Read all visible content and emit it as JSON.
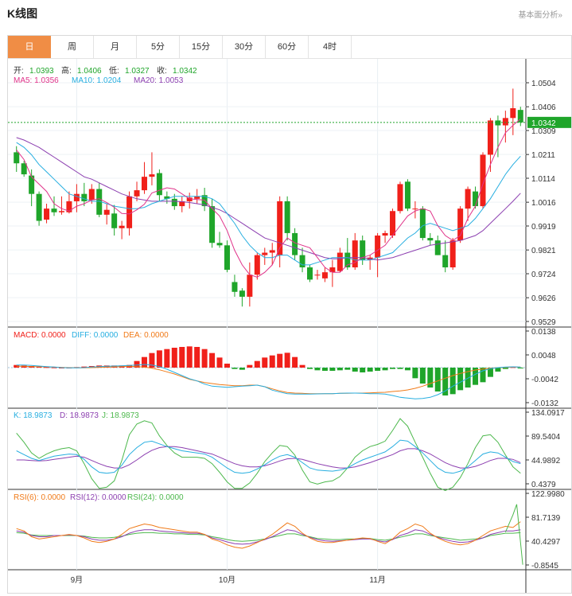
{
  "header": {
    "title": "K线图",
    "link": "基本面分析»"
  },
  "tabs": [
    "日",
    "周",
    "月",
    "5分",
    "15分",
    "30分",
    "60分",
    "4时"
  ],
  "active_tab": 0,
  "colors": {
    "up": "#f0201a",
    "down": "#1fa52a",
    "accent": "#f08d45",
    "ma5": "#e0338a",
    "ma10": "#27aee0",
    "ma20": "#8c3fb0",
    "k": "#27aee0",
    "d": "#8c3fb0",
    "j": "#4cb84c",
    "rsi6": "#f07a18",
    "rsi12": "#8c3fb0",
    "rsi24": "#4cb84c",
    "dea": "#f07a18",
    "diff": "#27aee0"
  },
  "ohlc": {
    "open_label": "开:",
    "open": "1.0393",
    "high_label": "高:",
    "high": "1.0406",
    "low_label": "低:",
    "low": "1.0327",
    "close_label": "收:",
    "close": "1.0342"
  },
  "ma_legend": {
    "ma5": "MA5: 1.0356",
    "ma10": "MA10: 1.0204",
    "ma20": "MA20: 1.0053"
  },
  "macd_legend": {
    "macd": "MACD: 0.0000",
    "diff": "DIFF: 0.0000",
    "dea": "DEA: 0.0000"
  },
  "kdj_legend": {
    "k": "K: 18.9873",
    "d": "D: 18.9873",
    "j": "J: 18.9873"
  },
  "rsi_legend": {
    "rsi6": "RSI(6): 0.0000",
    "rsi12": "RSI(12): 0.0000",
    "rsi24": "RSI(24): 0.0000"
  },
  "chart_data": [
    {
      "type": "candlestick",
      "x_labels": [
        "9月",
        "10月",
        "11月"
      ],
      "ylim": [
        0.9529,
        1.0504
      ],
      "y_ticks": [
        "1.0504",
        "1.0406",
        "1.0309",
        "1.0211",
        "1.0114",
        "1.0016",
        "0.9919",
        "0.9821",
        "0.9724",
        "0.9626",
        "0.9529"
      ],
      "current_price": "1.0342",
      "candles": [
        [
          1.022,
          1.0245,
          1.014,
          1.0175
        ],
        [
          1.0175,
          1.0185,
          1.012,
          1.013
        ],
        [
          1.0125,
          1.015,
          1.0,
          1.005
        ],
        [
          1.005,
          1.006,
          0.992,
          0.994
        ],
        [
          0.9945,
          1.001,
          0.993,
          0.999
        ],
        [
          0.999,
          1.004,
          0.996,
          0.9975
        ],
        [
          0.9975,
          1.004,
          0.9965,
          0.998
        ],
        [
          0.9975,
          1.006,
          0.997,
          1.002
        ],
        [
          1.002,
          1.009,
          0.9975,
          1.005
        ],
        [
          1.005,
          1.0095,
          1.0,
          1.002
        ],
        [
          1.0025,
          1.009,
          1.001,
          1.007
        ],
        [
          1.007,
          1.0095,
          0.9955,
          0.9965
        ],
        [
          0.9965,
          1.001,
          0.9925,
          0.9985
        ],
        [
          0.997,
          1.0005,
          0.988,
          0.991
        ],
        [
          0.991,
          0.994,
          0.9865,
          0.992
        ],
        [
          0.991,
          1.006,
          0.988,
          1.004
        ],
        [
          1.004,
          1.01,
          1.002,
          1.0065
        ],
        [
          1.0065,
          1.018,
          1.005,
          1.012
        ],
        [
          1.012,
          1.022,
          1.0085,
          1.013
        ],
        [
          1.0135,
          1.015,
          1.002,
          1.0045
        ],
        [
          1.004,
          1.006,
          1.001,
          1.003
        ],
        [
          1.003,
          1.005,
          0.9985,
          1.0
        ],
        [
          1.0,
          1.004,
          0.9975,
          1.002
        ],
        [
          1.002,
          1.0055,
          0.999,
          1.0035
        ],
        [
          1.003,
          1.007,
          1.001,
          1.004
        ],
        [
          1.0045,
          1.0075,
          0.998,
          1.0
        ],
        [
          1.0,
          1.003,
          0.983,
          0.985
        ],
        [
          0.985,
          0.9895,
          0.983,
          0.984
        ],
        [
          0.984,
          0.986,
          0.973,
          0.974
        ],
        [
          0.969,
          0.972,
          0.963,
          0.965
        ],
        [
          0.9655,
          0.9665,
          0.959,
          0.963
        ],
        [
          0.963,
          0.977,
          0.959,
          0.972
        ],
        [
          0.972,
          0.981,
          0.97,
          0.98
        ],
        [
          0.98,
          0.983,
          0.976,
          0.981
        ],
        [
          0.981,
          0.985,
          0.976,
          0.982
        ],
        [
          0.98,
          1.004,
          0.975,
          1.002
        ],
        [
          1.002,
          1.004,
          0.986,
          0.989
        ],
        [
          0.989,
          0.991,
          0.978,
          0.98
        ],
        [
          0.98,
          0.983,
          0.973,
          0.975
        ],
        [
          0.975,
          0.976,
          0.969,
          0.97
        ],
        [
          0.972,
          0.974,
          0.97,
          0.972
        ],
        [
          0.9705,
          0.975,
          0.969,
          0.973
        ],
        [
          0.973,
          0.978,
          0.967,
          0.975
        ],
        [
          0.9735,
          0.983,
          0.973,
          0.981
        ],
        [
          0.981,
          0.987,
          0.974,
          0.975
        ],
        [
          0.975,
          0.989,
          0.974,
          0.986
        ],
        [
          0.986,
          0.988,
          0.976,
          0.978
        ],
        [
          0.978,
          0.98,
          0.974,
          0.979
        ],
        [
          0.979,
          0.989,
          0.971,
          0.988
        ],
        [
          0.988,
          0.99,
          0.985,
          0.989
        ],
        [
          0.988,
          0.999,
          0.987,
          0.998
        ],
        [
          0.998,
          1.01,
          0.997,
          1.009
        ],
        [
          1.01,
          1.011,
          0.998,
          0.999
        ],
        [
          0.999,
          1.002,
          0.995,
          0.999
        ],
        [
          0.999,
          1.0,
          0.986,
          0.987
        ],
        [
          0.987,
          0.989,
          0.984,
          0.986
        ],
        [
          0.986,
          0.988,
          0.98,
          0.98
        ],
        [
          0.98,
          0.986,
          0.973,
          0.975
        ],
        [
          0.975,
          0.987,
          0.974,
          0.986
        ],
        [
          0.986,
          1.0,
          0.985,
          0.999
        ],
        [
          0.999,
          1.008,
          0.994,
          1.007
        ],
        [
          1.006,
          1.008,
          0.999,
          1.0
        ],
        [
          1.0,
          1.022,
          0.999,
          1.021
        ],
        [
          1.021,
          1.036,
          1.014,
          1.035
        ],
        [
          1.035,
          1.037,
          1.02,
          1.033
        ],
        [
          1.033,
          1.039,
          1.026,
          1.036
        ],
        [
          1.036,
          1.048,
          1.029,
          1.04
        ],
        [
          1.0393,
          1.0406,
          1.0327,
          1.0342
        ]
      ],
      "ma5": [
        1.023,
        1.019,
        1.012,
        1.009,
        1.006,
        1.001,
        0.999,
        0.998,
        1.0,
        1.001,
        1.0025,
        1.003,
        1.0015,
        0.9995,
        0.997,
        0.9968,
        0.9985,
        1.0008,
        1.0054,
        1.0065,
        1.0075,
        1.007,
        1.005,
        1.003,
        1.0027,
        1.0025,
        0.999,
        0.996,
        0.99,
        0.982,
        0.976,
        0.972,
        0.971,
        0.973,
        0.976,
        0.983,
        0.987,
        0.985,
        0.984,
        0.983,
        0.979,
        0.975,
        0.973,
        0.973,
        0.976,
        0.977,
        0.979,
        0.98,
        0.982,
        0.984,
        0.988,
        0.992,
        0.996,
        0.998,
        0.999,
        0.998,
        0.992,
        0.988,
        0.986,
        0.988,
        0.995,
        1.0,
        1.009,
        1.017,
        1.024,
        1.03,
        1.033,
        1.0356
      ],
      "ma10": [
        1.026,
        1.024,
        1.021,
        1.017,
        1.014,
        1.011,
        1.008,
        1.005,
        1.004,
        1.003,
        1.002,
        1.002,
        1.001,
        1.0,
        0.9995,
        0.999,
        0.999,
        0.9995,
        1.001,
        1.002,
        1.003,
        1.004,
        1.004,
        1.004,
        1.004,
        1.004,
        1.003,
        1.001,
        0.997,
        0.993,
        0.988,
        0.984,
        0.981,
        0.979,
        0.979,
        0.98,
        0.98,
        0.978,
        0.976,
        0.976,
        0.977,
        0.978,
        0.979,
        0.979,
        0.979,
        0.978,
        0.978,
        0.978,
        0.979,
        0.98,
        0.981,
        0.984,
        0.987,
        0.989,
        0.992,
        0.993,
        0.992,
        0.991,
        0.99,
        0.991,
        0.992,
        0.995,
        0.999,
        1.003,
        1.008,
        1.013,
        1.017,
        1.0204
      ],
      "ma20": [
        1.028,
        1.027,
        1.0255,
        1.024,
        1.022,
        1.02,
        1.018,
        1.016,
        1.014,
        1.012,
        1.011,
        1.0095,
        1.008,
        1.0065,
        1.005,
        1.004,
        1.003,
        1.0025,
        1.002,
        1.002,
        1.002,
        1.002,
        1.0018,
        1.0015,
        1.001,
        1.0005,
        0.9995,
        0.9985,
        0.997,
        0.995,
        0.993,
        0.991,
        0.989,
        0.987,
        0.986,
        0.985,
        0.984,
        0.983,
        0.982,
        0.981,
        0.98,
        0.979,
        0.9785,
        0.9785,
        0.979,
        0.979,
        0.979,
        0.9785,
        0.978,
        0.9785,
        0.979,
        0.98,
        0.981,
        0.982,
        0.983,
        0.984,
        0.9845,
        0.985,
        0.9855,
        0.986,
        0.987,
        0.988,
        0.99,
        0.993,
        0.996,
        0.999,
        1.002,
        1.0053
      ]
    },
    {
      "type": "bar",
      "name": "MACD",
      "ylim": [
        -0.0132,
        0.0138
      ],
      "y_ticks": [
        "0.0138",
        "0.0048",
        "-0.0042",
        "-0.0132"
      ],
      "hist": [
        0.001,
        0.0008,
        0.0006,
        0.0004,
        0.0002,
        0.0001,
        0.0,
        0.0,
        0.0002,
        0.0004,
        0.0006,
        0.0008,
        0.0008,
        0.0008,
        0.0008,
        0.001,
        0.0025,
        0.004,
        0.0055,
        0.0065,
        0.007,
        0.0075,
        0.0078,
        0.008,
        0.0078,
        0.007,
        0.0055,
        0.0038,
        0.0015,
        -0.0005,
        -0.0008,
        0.001,
        0.0025,
        0.0038,
        0.0046,
        0.0052,
        0.0056,
        0.004,
        0.001,
        -0.0005,
        -0.001,
        -0.0012,
        -0.0012,
        -0.001,
        -0.0008,
        -0.0015,
        -0.0018,
        -0.0015,
        -0.0012,
        -0.001,
        -0.0005,
        -0.0005,
        -0.001,
        -0.004,
        -0.006,
        -0.0075,
        -0.009,
        -0.0105,
        -0.01,
        -0.0085,
        -0.0075,
        -0.0065,
        -0.0055,
        -0.0035,
        -0.0015,
        -0.0005,
        0.0002,
        -0.0002
      ],
      "diff": [
        0.001,
        0.001,
        0.0008,
        0.0006,
        0.0004,
        0.0002,
        0.0,
        -0.0001,
        -0.0001,
        0.0,
        0.0002,
        0.0004,
        0.0005,
        0.0006,
        0.0007,
        0.0008,
        0.001,
        0.0012,
        0.001,
        0.0004,
        -0.0006,
        -0.0018,
        -0.003,
        -0.0042,
        -0.005,
        -0.0062,
        -0.007,
        -0.0072,
        -0.0074,
        -0.0072,
        -0.007,
        -0.0068,
        -0.0066,
        -0.0072,
        -0.0085,
        -0.0092,
        -0.0098,
        -0.01,
        -0.01,
        -0.01,
        -0.0099,
        -0.0098,
        -0.0098,
        -0.0097,
        -0.0096,
        -0.0096,
        -0.0097,
        -0.0098,
        -0.0098,
        -0.01,
        -0.0105,
        -0.0112,
        -0.0115,
        -0.0118,
        -0.0116,
        -0.0112,
        -0.0102,
        -0.0088,
        -0.007,
        -0.0055,
        -0.004,
        -0.0025,
        -0.0012,
        -0.0004,
        0.0,
        0.0002,
        0.0003,
        0.0002
      ],
      "dea": [
        0.0005,
        0.0005,
        0.0004,
        0.0004,
        0.0003,
        0.0002,
        0.0001,
        0.0,
        -0.0001,
        -0.0001,
        0.0,
        0.0001,
        0.0002,
        0.0003,
        0.0004,
        0.0005,
        0.0004,
        0.0002,
        -0.0002,
        -0.0008,
        -0.0016,
        -0.0024,
        -0.0034,
        -0.0044,
        -0.005,
        -0.0056,
        -0.006,
        -0.0064,
        -0.0066,
        -0.0068,
        -0.0068,
        -0.0066,
        -0.0066,
        -0.0072,
        -0.008,
        -0.0088,
        -0.0094,
        -0.0096,
        -0.0097,
        -0.0098,
        -0.0098,
        -0.0098,
        -0.0098,
        -0.0097,
        -0.0097,
        -0.0096,
        -0.0096,
        -0.0095,
        -0.0094,
        -0.0093,
        -0.009,
        -0.0088,
        -0.0084,
        -0.0078,
        -0.007,
        -0.006,
        -0.005,
        -0.004,
        -0.003,
        -0.0022,
        -0.0015,
        -0.0009,
        -0.0005,
        -0.0002,
        0.0,
        0.0001,
        0.0002,
        0.0002
      ]
    },
    {
      "type": "line",
      "name": "KDJ",
      "ylim": [
        0.4379,
        134.0917
      ],
      "y_ticks": [
        "134.0917",
        "89.5404",
        "44.9892",
        "0.4379"
      ],
      "k": [
        62,
        55,
        48,
        44,
        48,
        52,
        54,
        56,
        55,
        46,
        32,
        22,
        20,
        22,
        35,
        55,
        68,
        78,
        80,
        75,
        70,
        66,
        62,
        60,
        58,
        56,
        50,
        40,
        30,
        22,
        20,
        22,
        28,
        36,
        45,
        52,
        55,
        50,
        40,
        30,
        26,
        25,
        24,
        26,
        30,
        38,
        45,
        50,
        55,
        60,
        70,
        82,
        80,
        70,
        58,
        44,
        30,
        22,
        20,
        24,
        32,
        44,
        56,
        60,
        58,
        50,
        42,
        38
      ],
      "d": [
        45,
        45,
        44,
        43,
        44,
        46,
        48,
        50,
        52,
        50,
        44,
        38,
        33,
        30,
        30,
        36,
        45,
        55,
        63,
        68,
        70,
        70,
        68,
        65,
        62,
        59,
        56,
        50,
        44,
        38,
        34,
        32,
        32,
        34,
        38,
        43,
        47,
        48,
        46,
        42,
        38,
        35,
        32,
        30,
        30,
        32,
        36,
        40,
        45,
        50,
        55,
        62,
        66,
        66,
        62,
        56,
        48,
        40,
        34,
        30,
        30,
        33,
        38,
        44,
        48,
        48,
        46,
        40
      ],
      "j": [
        95,
        78,
        58,
        48,
        56,
        62,
        66,
        68,
        62,
        38,
        10,
        -8,
        -6,
        6,
        44,
        92,
        112,
        118,
        114,
        90,
        72,
        58,
        50,
        50,
        50,
        48,
        38,
        22,
        4,
        -8,
        -8,
        2,
        20,
        42,
        58,
        72,
        70,
        54,
        26,
        4,
        0,
        4,
        6,
        14,
        30,
        50,
        62,
        70,
        74,
        80,
        100,
        122,
        108,
        78,
        50,
        20,
        -6,
        -12,
        -6,
        12,
        38,
        68,
        90,
        92,
        78,
        54,
        32,
        20
      ]
    },
    {
      "type": "line",
      "name": "RSI",
      "ylim": [
        -0.8545,
        122.998
      ],
      "y_ticks": [
        "122.9980",
        "81.7139",
        "40.4297",
        "-0.8545"
      ],
      "rsi6": [
        62,
        58,
        48,
        44,
        46,
        48,
        50,
        52,
        50,
        46,
        40,
        38,
        40,
        44,
        52,
        62,
        66,
        70,
        68,
        64,
        62,
        60,
        58,
        56,
        56,
        52,
        44,
        40,
        34,
        30,
        28,
        32,
        38,
        44,
        52,
        62,
        72,
        66,
        54,
        46,
        40,
        38,
        38,
        40,
        42,
        44,
        46,
        45,
        40,
        36,
        44,
        56,
        62,
        70,
        66,
        54,
        46,
        40,
        36,
        34,
        36,
        42,
        50,
        58,
        62,
        66,
        64,
        74
      ],
      "rsi12": [
        58,
        56,
        50,
        48,
        48,
        50,
        50,
        51,
        50,
        48,
        44,
        42,
        42,
        44,
        48,
        54,
        58,
        60,
        60,
        58,
        57,
        56,
        55,
        54,
        54,
        52,
        46,
        43,
        39,
        36,
        35,
        36,
        39,
        43,
        48,
        54,
        60,
        58,
        52,
        47,
        43,
        41,
        40,
        41,
        42,
        43,
        44,
        44,
        41,
        39,
        43,
        50,
        54,
        60,
        58,
        52,
        47,
        43,
        40,
        38,
        39,
        42,
        46,
        52,
        55,
        58,
        58,
        60
      ],
      "rsi24": [
        55,
        54,
        51,
        50,
        50,
        50,
        50,
        50,
        50,
        49,
        47,
        46,
        46,
        47,
        49,
        52,
        54,
        55,
        55,
        54,
        54,
        53,
        53,
        52,
        52,
        51,
        48,
        46,
        43,
        41,
        40,
        41,
        42,
        44,
        47,
        50,
        53,
        53,
        50,
        48,
        45,
        44,
        43,
        43,
        44,
        44,
        45,
        45,
        43,
        42,
        44,
        47,
        50,
        53,
        53,
        50,
        48,
        46,
        44,
        42,
        43,
        44,
        46,
        50,
        52,
        54,
        54,
        55
      ],
      "rsi_tail": [
        86,
        104,
        -0.5
      ]
    }
  ]
}
